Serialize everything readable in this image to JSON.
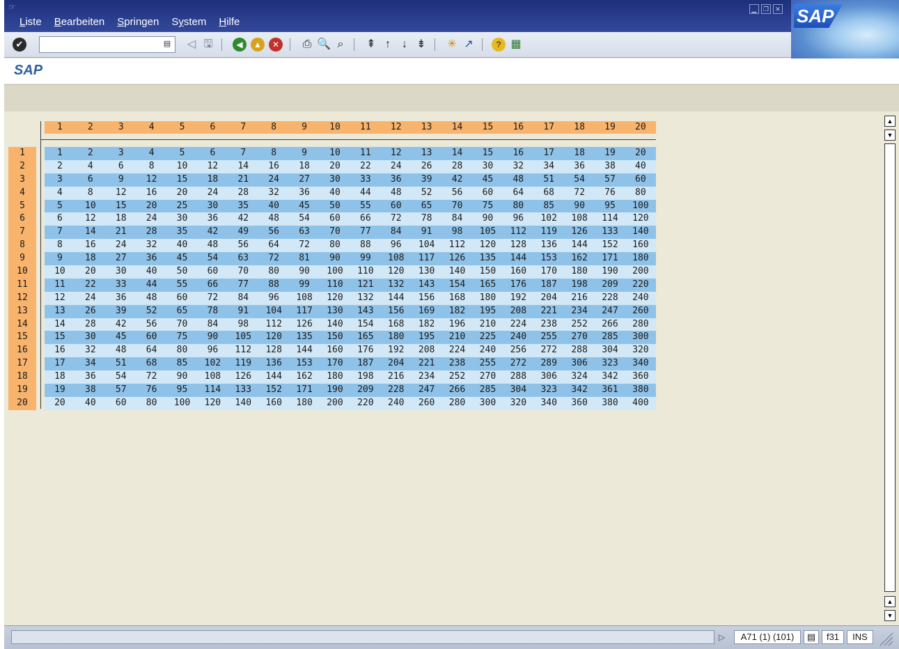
{
  "menu": {
    "items": [
      {
        "label_pre": "",
        "mnemonic": "L",
        "label_post": "iste"
      },
      {
        "label_pre": "",
        "mnemonic": "B",
        "label_post": "earbeiten"
      },
      {
        "label_pre": "",
        "mnemonic": "S",
        "label_post": "pringen"
      },
      {
        "label_pre": "S",
        "mnemonic": "y",
        "label_post": "stem"
      },
      {
        "label_pre": "",
        "mnemonic": "H",
        "label_post": "ilfe"
      }
    ]
  },
  "brand": {
    "logo_text": "SAP"
  },
  "toolbar": {
    "command_field_value": "",
    "icons": [
      "enter-icon",
      "dropdown-icon",
      "back-arrow-icon",
      "save-icon",
      "green-back-icon",
      "exit-icon",
      "cancel-icon",
      "print-icon",
      "find-icon",
      "find-next-icon",
      "first-page-icon",
      "previous-page-icon",
      "next-page-icon",
      "last-page-icon",
      "create-session-icon",
      "shortcut-icon",
      "help-icon",
      "layout-icon"
    ]
  },
  "page": {
    "title": "SAP"
  },
  "table": {
    "columns": [
      "1",
      "2",
      "3",
      "4",
      "5",
      "6",
      "7",
      "8",
      "9",
      "10",
      "11",
      "12",
      "13",
      "14",
      "15",
      "16",
      "17",
      "18",
      "19",
      "20"
    ],
    "rows": [
      "1",
      "2",
      "3",
      "4",
      "5",
      "6",
      "7",
      "8",
      "9",
      "10",
      "11",
      "12",
      "13",
      "14",
      "15",
      "16",
      "17",
      "18",
      "19",
      "20"
    ],
    "cells": [
      [
        "1",
        "2",
        "3",
        "4",
        "5",
        "6",
        "7",
        "8",
        "9",
        "10",
        "11",
        "12",
        "13",
        "14",
        "15",
        "16",
        "17",
        "18",
        "19",
        "20"
      ],
      [
        "2",
        "4",
        "6",
        "8",
        "10",
        "12",
        "14",
        "16",
        "18",
        "20",
        "22",
        "24",
        "26",
        "28",
        "30",
        "32",
        "34",
        "36",
        "38",
        "40"
      ],
      [
        "3",
        "6",
        "9",
        "12",
        "15",
        "18",
        "21",
        "24",
        "27",
        "30",
        "33",
        "36",
        "39",
        "42",
        "45",
        "48",
        "51",
        "54",
        "57",
        "60"
      ],
      [
        "4",
        "8",
        "12",
        "16",
        "20",
        "24",
        "28",
        "32",
        "36",
        "40",
        "44",
        "48",
        "52",
        "56",
        "60",
        "64",
        "68",
        "72",
        "76",
        "80"
      ],
      [
        "5",
        "10",
        "15",
        "20",
        "25",
        "30",
        "35",
        "40",
        "45",
        "50",
        "55",
        "60",
        "65",
        "70",
        "75",
        "80",
        "85",
        "90",
        "95",
        "100"
      ],
      [
        "6",
        "12",
        "18",
        "24",
        "30",
        "36",
        "42",
        "48",
        "54",
        "60",
        "66",
        "72",
        "78",
        "84",
        "90",
        "96",
        "102",
        "108",
        "114",
        "120"
      ],
      [
        "7",
        "14",
        "21",
        "28",
        "35",
        "42",
        "49",
        "56",
        "63",
        "70",
        "77",
        "84",
        "91",
        "98",
        "105",
        "112",
        "119",
        "126",
        "133",
        "140"
      ],
      [
        "8",
        "16",
        "24",
        "32",
        "40",
        "48",
        "56",
        "64",
        "72",
        "80",
        "88",
        "96",
        "104",
        "112",
        "120",
        "128",
        "136",
        "144",
        "152",
        "160"
      ],
      [
        "9",
        "18",
        "27",
        "36",
        "45",
        "54",
        "63",
        "72",
        "81",
        "90",
        "99",
        "108",
        "117",
        "126",
        "135",
        "144",
        "153",
        "162",
        "171",
        "180"
      ],
      [
        "10",
        "20",
        "30",
        "40",
        "50",
        "60",
        "70",
        "80",
        "90",
        "100",
        "110",
        "120",
        "130",
        "140",
        "150",
        "160",
        "170",
        "180",
        "190",
        "200"
      ],
      [
        "11",
        "22",
        "33",
        "44",
        "55",
        "66",
        "77",
        "88",
        "99",
        "110",
        "121",
        "132",
        "143",
        "154",
        "165",
        "176",
        "187",
        "198",
        "209",
        "220"
      ],
      [
        "12",
        "24",
        "36",
        "48",
        "60",
        "72",
        "84",
        "96",
        "108",
        "120",
        "132",
        "144",
        "156",
        "168",
        "180",
        "192",
        "204",
        "216",
        "228",
        "240"
      ],
      [
        "13",
        "26",
        "39",
        "52",
        "65",
        "78",
        "91",
        "104",
        "117",
        "130",
        "143",
        "156",
        "169",
        "182",
        "195",
        "208",
        "221",
        "234",
        "247",
        "260"
      ],
      [
        "14",
        "28",
        "42",
        "56",
        "70",
        "84",
        "98",
        "112",
        "126",
        "140",
        "154",
        "168",
        "182",
        "196",
        "210",
        "224",
        "238",
        "252",
        "266",
        "280"
      ],
      [
        "15",
        "30",
        "45",
        "60",
        "75",
        "90",
        "105",
        "120",
        "135",
        "150",
        "165",
        "180",
        "195",
        "210",
        "225",
        "240",
        "255",
        "270",
        "285",
        "300"
      ],
      [
        "16",
        "32",
        "48",
        "64",
        "80",
        "96",
        "112",
        "128",
        "144",
        "160",
        "176",
        "192",
        "208",
        "224",
        "240",
        "256",
        "272",
        "288",
        "304",
        "320"
      ],
      [
        "17",
        "34",
        "51",
        "68",
        "85",
        "102",
        "119",
        "136",
        "153",
        "170",
        "187",
        "204",
        "221",
        "238",
        "255",
        "272",
        "289",
        "306",
        "323",
        "340"
      ],
      [
        "18",
        "36",
        "54",
        "72",
        "90",
        "108",
        "126",
        "144",
        "162",
        "180",
        "198",
        "216",
        "234",
        "252",
        "270",
        "288",
        "306",
        "324",
        "342",
        "360"
      ],
      [
        "19",
        "38",
        "57",
        "76",
        "95",
        "114",
        "133",
        "152",
        "171",
        "190",
        "209",
        "228",
        "247",
        "266",
        "285",
        "304",
        "323",
        "342",
        "361",
        "380"
      ],
      [
        "20",
        "40",
        "60",
        "80",
        "100",
        "120",
        "140",
        "160",
        "180",
        "200",
        "220",
        "240",
        "260",
        "280",
        "300",
        "320",
        "340",
        "360",
        "380",
        "400"
      ]
    ]
  },
  "statusbar": {
    "message": "",
    "system": "A71 (1) (101)",
    "server": "f31",
    "mode": "INS"
  },
  "colors": {
    "header": "#f8b46c",
    "row_odd": "#8fc2e8",
    "row_even": "#d2e8f7",
    "background": "#ece9d8"
  }
}
